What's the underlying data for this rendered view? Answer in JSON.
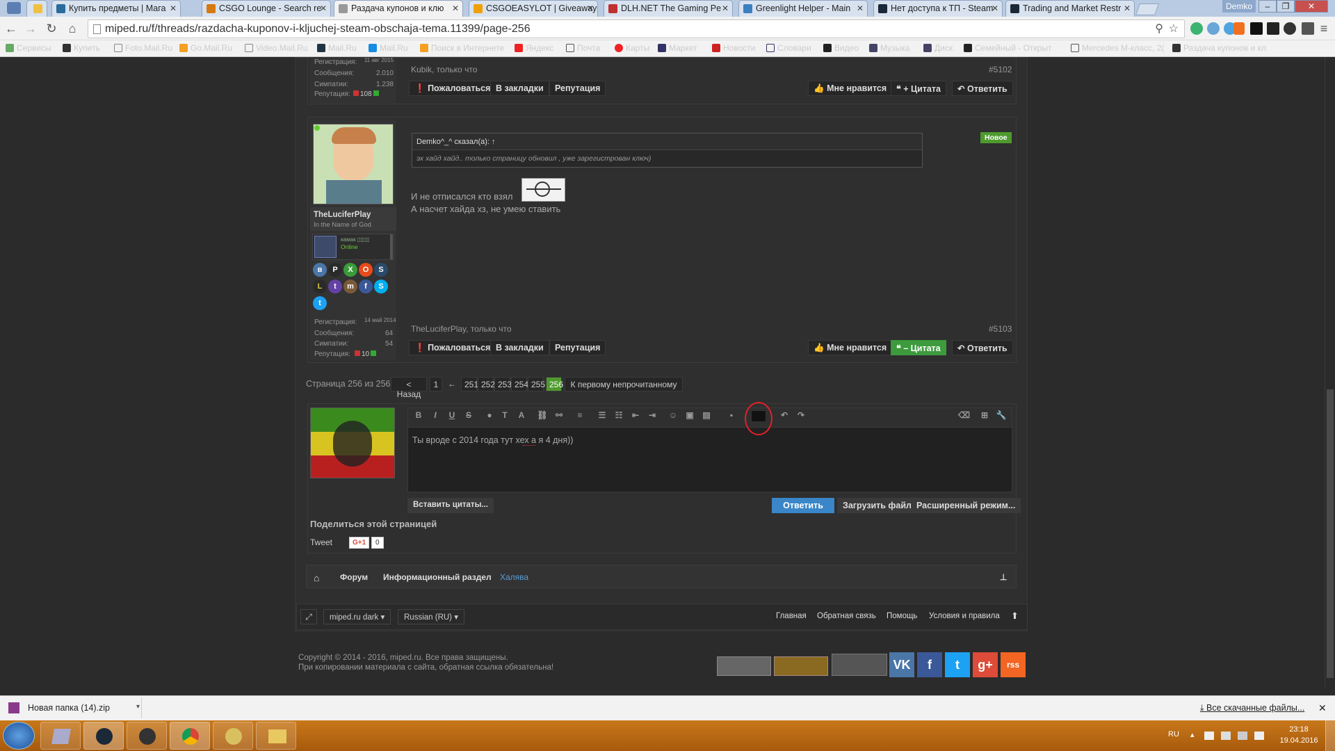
{
  "browser": {
    "tabs": [
      {
        "title": "Купить предметы | Мага",
        "fav": "#2a6b9c"
      },
      {
        "title": "CSGO Lounge - Search re",
        "fav": "#d47a10"
      },
      {
        "title": "Раздача купонов и клю",
        "fav": "#999999"
      },
      {
        "title": "CSGOEASYLOT | Giveaway",
        "fav": "#f0a000"
      },
      {
        "title": "DLH.NET The Gaming Pe",
        "fav": "#c03030"
      },
      {
        "title": "Greenlight Helper - Main",
        "fav": "#3a7fc0"
      },
      {
        "title": "Нет доступа к ТП - Steam",
        "fav": "#1b2838"
      },
      {
        "title": "Trading and Market Restr",
        "fav": "#1b2838"
      }
    ],
    "user": "Demko",
    "url": "miped.ru/f/threads/razdacha-kuponov-i-kljuchej-steam-obschaja-tema.11399/page-256",
    "bookmarks": [
      "Сервисы",
      "Купить",
      "Foto.Mail.Ru",
      "Go.Mail.Ru",
      "Video.Mail.Ru",
      "Mail.Ru",
      "Mail.Ru",
      "Поиск в Интернете",
      "Яндекс",
      "Почта",
      "Карты",
      "Маркет",
      "Новости",
      "Словари",
      "Видео",
      "Музыка",
      "Диск",
      "Семейный - Открыт",
      "Mercedes M-класс, 2(",
      "Раздача купонов и кл"
    ]
  },
  "post1": {
    "user_stats": {
      "reg_label": "Регистрация:",
      "reg": "11 авг 2015",
      "msgs_label": "Сообщения:",
      "msgs": "2.010",
      "symp_label": "Симпатии:",
      "symp": "1.238",
      "rep_label": "Репутация:",
      "rep": "108"
    },
    "author_time": "Kubik, только что",
    "number": "#5102"
  },
  "post2": {
    "username": "TheLuciferPlay",
    "usertitle": "In the Name of God",
    "mini_name": "камак ▯▯▯▯",
    "mini_status": "Online",
    "new_badge": "Новое",
    "quote_author": "Demko^_^ сказал(а): ↑",
    "quote_text": "эх хайд хайд.. только страницу обновил , уже зарегистрован ключ)",
    "text_line1": "И не отписался кто взял",
    "text_line2": "А насчет хайда хз, не умею ставить",
    "user_stats": {
      "reg_label": "Регистрация:",
      "reg": "14 май 2014",
      "msgs_label": "Сообщения:",
      "msgs": "64",
      "symp_label": "Симпатии:",
      "symp": "54",
      "rep_label": "Репутация:",
      "rep": "10"
    },
    "author_time": "TheLuciferPlay, только что",
    "number": "#5103"
  },
  "actions": {
    "report": "Пожаловаться",
    "bookmark": "В закладки",
    "reputation": "Репутация",
    "like": "Мне нравится",
    "quote_plus": "+ Цитата",
    "quote_minus": "– Цитата",
    "reply": "Ответить"
  },
  "pagination": {
    "label": "Страница 256 из 256",
    "prev": "< Назад",
    "first": "1",
    "ellipsis": "←",
    "pages": [
      "251",
      "252",
      "253",
      "254",
      "255"
    ],
    "current": "256",
    "unread": "К первому непрочитанному"
  },
  "editor": {
    "text": "Ты вроде с 2014 года тут хех а я 4 дня))",
    "insert_quotes": "Вставить цитаты...",
    "reply": "Ответить",
    "upload": "Загрузить файл",
    "advanced": "Расширенный режим..."
  },
  "share": {
    "title": "Поделиться этой страницей",
    "tweet": "Tweet",
    "gplus": "G+1",
    "gcount": "0"
  },
  "breadcrumb": [
    "Форум",
    "Информационный раздел",
    "Халява"
  ],
  "footer": {
    "style": "miped.ru dark",
    "lang": "Russian (RU)",
    "links": [
      "Главная",
      "Обратная связь",
      "Помощь",
      "Условия и правила"
    ],
    "copyright1": "Copyright © 2014 - 2016, miped.ru. Все права защищены.",
    "copyright2": "При копировании материала с сайта, обратная ссылка обязательна!",
    "social": [
      {
        "label": "VK",
        "color": "#4a76a8"
      },
      {
        "label": "f",
        "color": "#3b5998"
      },
      {
        "label": "t",
        "color": "#1da1f2"
      },
      {
        "label": "g+",
        "color": "#dd4b39"
      },
      {
        "label": "rss",
        "color": "#f26522"
      }
    ]
  },
  "download": {
    "file": "Новая папка (14).zip",
    "all": "Все скачанные файлы..."
  },
  "tray": {
    "lang": "RU",
    "time": "23:18",
    "date": "19.04.2016"
  }
}
